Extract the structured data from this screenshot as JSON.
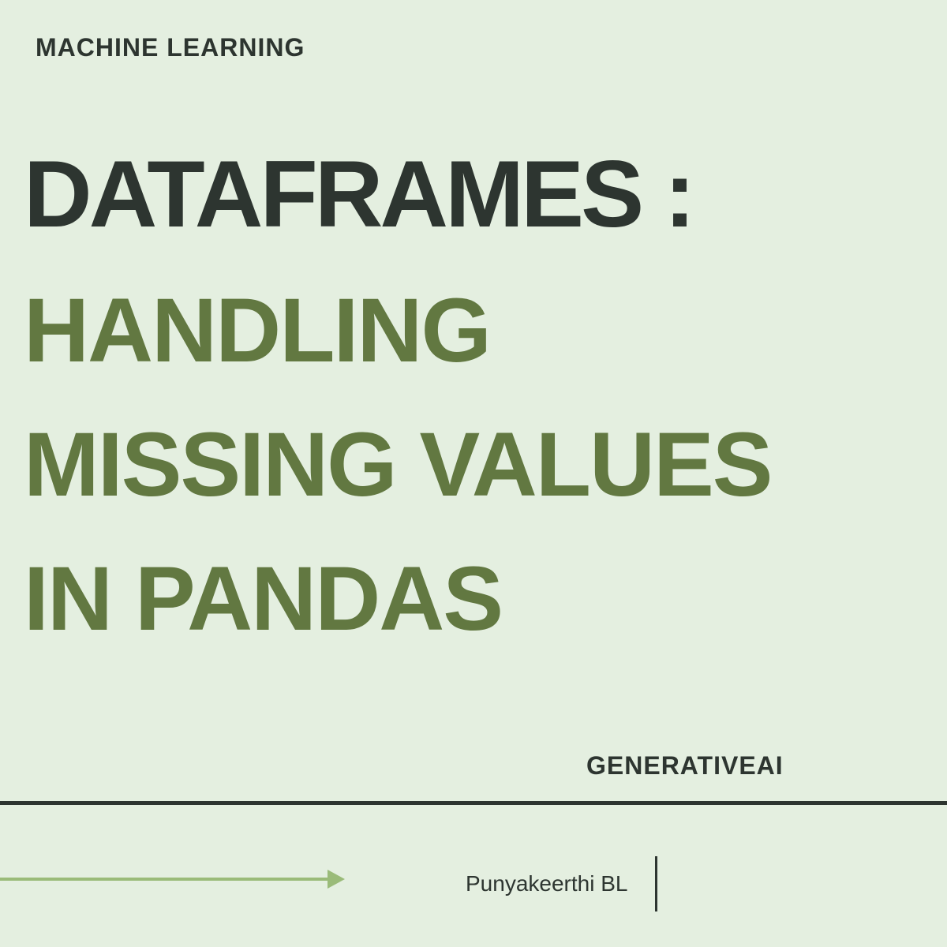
{
  "category": "MACHINE LEARNING",
  "title": {
    "line1": "DATAFRAMES :",
    "line2": "HANDLING",
    "line3": "MISSING VALUES",
    "line4": "IN PANDAS"
  },
  "tag": "GENERATIVEAI",
  "author": "Punyakeerthi BL",
  "colors": {
    "background": "#e4efe0",
    "dark_text": "#2d3530",
    "accent_text": "#627841",
    "arrow": "#9abb79"
  }
}
